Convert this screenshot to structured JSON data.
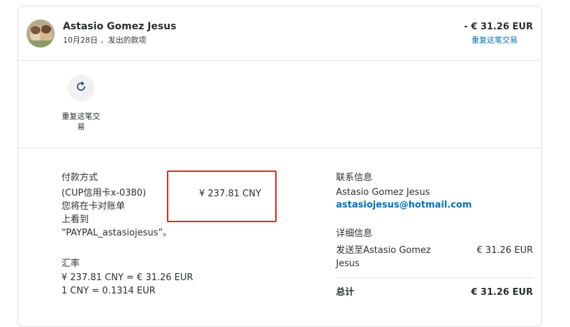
{
  "header": {
    "payee_name": "Astasio Gomez Jesus",
    "subtitle": "10月28日 ．发出的款项",
    "amount": "- € 31.26 EUR",
    "repeat_link": "重复这笔交易"
  },
  "actions": {
    "repeat_label": "重复这笔交易"
  },
  "payment": {
    "heading": "付款方式",
    "method_line1": "(CUP信用卡x-0380)",
    "method_line2": "您将在卡对账单",
    "method_line3": "上看到",
    "method_line4": "“PAYPAL_astasiojesus”。",
    "amount_cny": "¥ 237.81 CNY"
  },
  "exchange": {
    "heading": "汇率",
    "line1": "¥ 237.81 CNY = € 31.26 EUR",
    "line2": "1 CNY = 0.1314 EUR"
  },
  "contact": {
    "heading": "联系信息",
    "name": "Astasio Gomez Jesus",
    "email": "astasiojesus@hotmail.com"
  },
  "details": {
    "heading": "详细信息",
    "sent_to_line1": "发送至Astasio Gomez",
    "sent_to_line2": "Jesus",
    "sent_amount": "€ 31.26 EUR",
    "total_label": "总计",
    "total_amount": "€ 31.26 EUR"
  },
  "colors": {
    "link": "#0070ba",
    "highlight": "#e0281e"
  },
  "icons": {
    "repeat": "refresh-icon",
    "avatar": "avatar-photo"
  }
}
